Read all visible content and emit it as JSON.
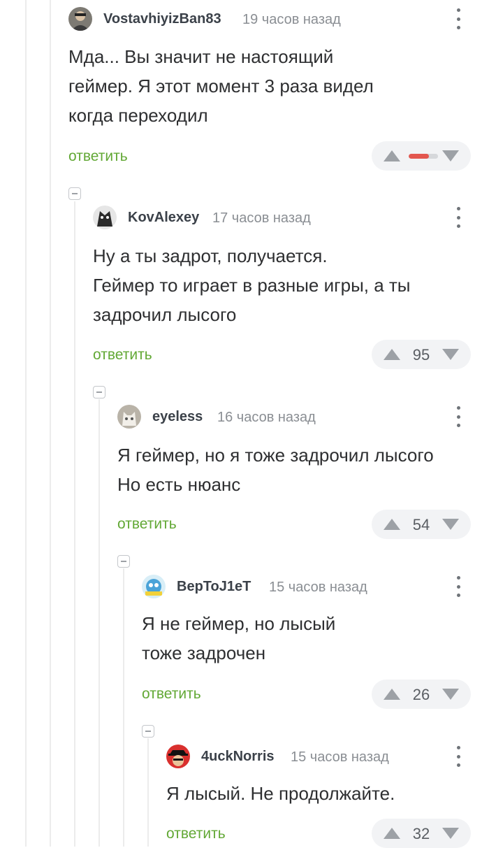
{
  "colors": {
    "reply": "#62a835",
    "rating_negative": "#e3574f",
    "text": "#2e2f31",
    "muted": "#8a8e93"
  },
  "comments": [
    {
      "author": "VostavhiyizBan83",
      "time": "19 часов назад",
      "lines": [
        "Мда... Вы значит не настоящий",
        "геймер. Я этот момент 3 раза видел",
        "когда переходил"
      ],
      "reply_label": "ответить",
      "score": "",
      "negative_ratio": 0.7,
      "avatar_icon": "user-avatar-icon"
    },
    {
      "author": "KovAlexey",
      "time": "17 часов назад",
      "lines": [
        "Ну а ты задрот, получается.",
        "Геймер то играет в разные игры, а ты",
        "задрочил лысого"
      ],
      "reply_label": "ответить",
      "score": "95",
      "avatar_icon": "user-avatar-icon"
    },
    {
      "author": "eyeless",
      "time": "16 часов назад",
      "lines": [
        "Я геймер, но я тоже задрочил лысого",
        "Но есть нюанс"
      ],
      "reply_label": "ответить",
      "score": "54",
      "avatar_icon": "cat-avatar-icon"
    },
    {
      "author": "BepToJ1eT",
      "time": "15 часов назад",
      "lines": [
        "Я не геймер, но лысый",
        "тоже задрочен"
      ],
      "reply_label": "ответить",
      "score": "26",
      "avatar_icon": "cartoon-avatar-icon"
    },
    {
      "author": "4uckNorris",
      "time": "15 часов назад",
      "lines": [
        "Я лысый. Не продолжайте."
      ],
      "reply_label": "ответить",
      "score": "32",
      "avatar_icon": "hat-avatar-icon"
    }
  ]
}
